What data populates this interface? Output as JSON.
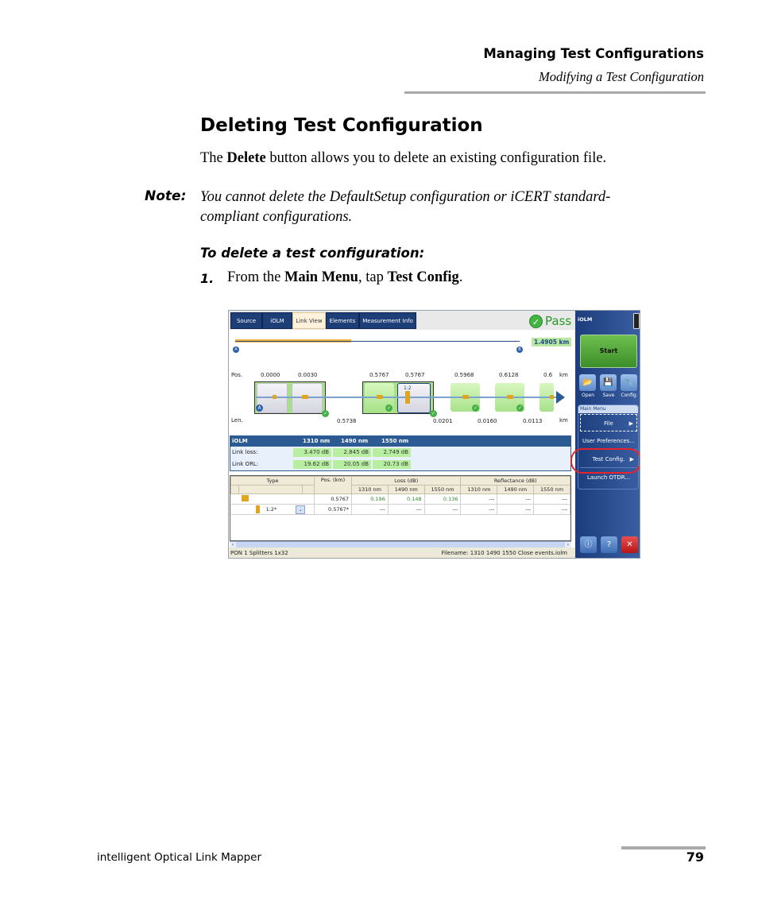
{
  "header": {
    "chapter": "Managing Test Configurations",
    "section": "Modifying a Test Configuration"
  },
  "content": {
    "heading": "Deleting Test Configuration",
    "intro": {
      "before": "The ",
      "bold": "Delete",
      "after": " button allows you to delete an existing configuration file."
    },
    "note_label": "Note:",
    "note_text": "You cannot delete the DefaultSetup configuration or iCERT standard-compliant configurations.",
    "procedure_title": "To delete a test configuration:",
    "steps": [
      {
        "num": "1.",
        "t1": "From the ",
        "b1": "Main Menu",
        "t2": ", tap ",
        "b2": "Test Config",
        "t3": "."
      }
    ]
  },
  "screenshot": {
    "tabs": [
      "Source",
      "iOLM",
      "Link View",
      "Elements",
      "Measurement Info"
    ],
    "active_tab": "Link View",
    "result": "Pass",
    "overview": {
      "a_label": "A",
      "b_label": "B",
      "total_length": "1.4905 km"
    },
    "link_view": {
      "pos_label": "Pos.",
      "len_label": "Len.",
      "unit": "km",
      "positions": [
        "0.0000",
        "0.0030",
        "0.5767",
        "0.5767",
        "0.5968",
        "0.6128",
        "0.6"
      ],
      "lengths": [
        "0.5738",
        "0.0201",
        "0.0160",
        "0.0113"
      ],
      "splitter_label": "1:2",
      "start_marker": "A"
    },
    "iolm_table": {
      "header": [
        "iOLM",
        "1310 nm",
        "1490 nm",
        "1550 nm"
      ],
      "rows": [
        {
          "label": "Link loss:",
          "values": [
            "3.470 dB",
            "2.845 dB",
            "2.749 dB"
          ]
        },
        {
          "label": "Link ORL:",
          "values": [
            "19.62 dB",
            "20.05 dB",
            "20.73 dB"
          ]
        }
      ]
    },
    "events_table": {
      "group_headers": [
        "Type",
        "Pos. (km)",
        "Loss (dB)",
        "Reflectance (dB)"
      ],
      "sub_headers": [
        "1310 nm",
        "1490 nm",
        "1550 nm",
        "1310 nm",
        "1490 nm",
        "1550 nm"
      ],
      "rows": [
        {
          "type": "",
          "pos": "0.5767",
          "loss": [
            "0.196",
            "0.148",
            "0.136"
          ],
          "refl": [
            "---",
            "---",
            "---"
          ]
        },
        {
          "type": "1:2*",
          "pos": "0.5767*",
          "loss": [
            "---",
            "---",
            "---"
          ],
          "refl": [
            "---",
            "---",
            "---"
          ]
        }
      ]
    },
    "status_bar": {
      "left": "PON 1 Splitters 1x32",
      "right": "Filename: 1310 1490 1550 Close events.iolm"
    },
    "side_panel": {
      "title": "iOLM",
      "start": "Start",
      "buttons": [
        "Open",
        "Save",
        "Config."
      ],
      "menu_title": "Main Menu",
      "menu_items": [
        "File",
        "User Preferences...",
        "Test Config.",
        "Launch OTDR..."
      ],
      "highlighted_item": "Test Config."
    },
    "colors": {
      "accent": "#1e3e78",
      "pass": "#2a9a2a",
      "highlight": "#e8232b"
    }
  },
  "footer": {
    "product": "intelligent Optical Link Mapper",
    "page": "79"
  }
}
